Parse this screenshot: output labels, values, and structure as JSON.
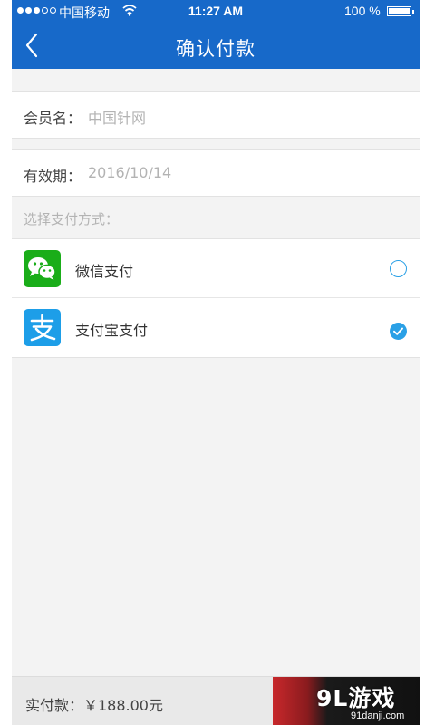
{
  "status_bar": {
    "carrier": "中国移动",
    "time": "11:27 AM",
    "battery": "100 %"
  },
  "nav": {
    "title": "确认付款"
  },
  "form": {
    "member_label": "会员名：",
    "member_value": "中国针网",
    "validity_label": "有效期：",
    "validity_value": "2016/10/14"
  },
  "payment": {
    "section_label": "选择支付方式：",
    "methods": [
      {
        "label": "微信支付",
        "icon": "wechat-icon",
        "color": "#1aad19",
        "selected": false
      },
      {
        "label": "支付宝支付",
        "icon": "alipay-icon",
        "color": "#1d9ee8",
        "selected": true
      }
    ]
  },
  "footer": {
    "amount_label": "实付款：￥188.00元"
  },
  "watermark": {
    "main": "9L游戏",
    "sub": "91danji.com"
  },
  "colors": {
    "header": "#1769c9",
    "accent": "#2aa0e6"
  }
}
